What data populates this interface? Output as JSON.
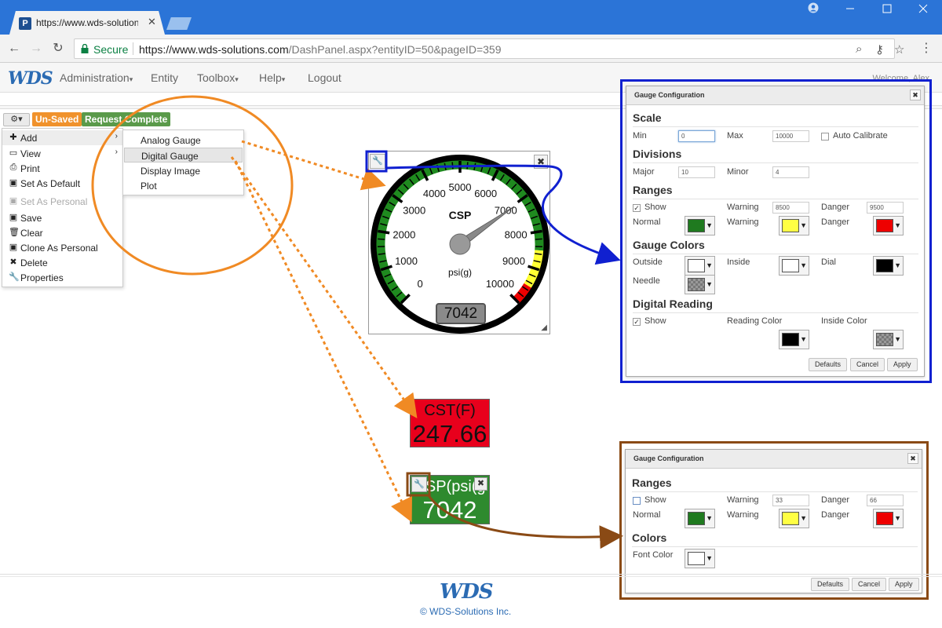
{
  "browser": {
    "tab_title": "https://www.wds-solution",
    "tab_close": "✕",
    "favicon_letter": "P",
    "secure_label": "Secure",
    "url_host": "https://www.wds-solutions.com",
    "url_path": "/DashPanel.aspx?entityID=50&pageID=359",
    "window_controls": [
      "minimize-icon",
      "maximize-icon",
      "close-icon"
    ]
  },
  "app": {
    "logo": "WDS",
    "nav": [
      {
        "label": "Administration",
        "has_dropdown": true
      },
      {
        "label": "Entity",
        "has_dropdown": false
      },
      {
        "label": "Toolbox",
        "has_dropdown": true
      },
      {
        "label": "Help",
        "has_dropdown": true
      },
      {
        "label": "Logout",
        "has_dropdown": false
      }
    ],
    "welcome": "Welcome, Alex"
  },
  "toolbar": {
    "gear": "⚙▾",
    "badge_unsaved": "Un-Saved",
    "badge_complete": "Request Complete"
  },
  "menu": {
    "items": [
      {
        "label": "Add",
        "icon": "plus-icon",
        "submenu": true
      },
      {
        "label": "View",
        "icon": "window-icon",
        "submenu": true
      },
      {
        "label": "Print",
        "icon": "print-icon"
      },
      {
        "label": "Set As Default",
        "icon": "save-icon"
      },
      {
        "label": "Set As Personal",
        "icon": "save-icon",
        "disabled": true
      },
      {
        "label": "Save",
        "icon": "save-icon"
      },
      {
        "label": "Clear",
        "icon": "trash-icon"
      },
      {
        "label": "Clone As Personal",
        "icon": "save-icon"
      },
      {
        "label": "Delete",
        "icon": "x-icon"
      },
      {
        "label": "Properties",
        "icon": "wrench-icon"
      }
    ],
    "submenu": [
      "Analog Gauge",
      "Digital Gauge",
      "Display Image",
      "Plot"
    ],
    "submenu_selected": "Digital Gauge"
  },
  "analog_gauge": {
    "label": "CSP",
    "unit": "psi(g)",
    "min": 0,
    "max": 10000,
    "major": 10,
    "warning_from": 8500,
    "danger_from": 9500,
    "value": 7042,
    "reading": "7042",
    "ticks": [
      "0",
      "1000",
      "2000",
      "3000",
      "4000",
      "5000",
      "6000",
      "7000",
      "8000",
      "9000",
      "10000"
    ],
    "colors": {
      "normal": "#1f8a1f",
      "warning": "#ffff33",
      "danger": "#ee0000",
      "dial": "#000000",
      "inside": "#ffffff",
      "outside": "#ffffff",
      "needle": "#888888"
    }
  },
  "digital_gauges": [
    {
      "label": "CST(F)",
      "value": "247.66",
      "background": "#e8001c"
    },
    {
      "label": "CSP(psi(g",
      "value": "7042",
      "background": "#2e8a2e"
    }
  ],
  "dialog_analog": {
    "title": "Gauge Configuration",
    "scale": {
      "heading": "Scale",
      "min_label": "Min",
      "min": "0",
      "max_label": "Max",
      "max": "10000",
      "auto_label": "Auto Calibrate",
      "auto": false
    },
    "divisions": {
      "heading": "Divisions",
      "major_label": "Major",
      "major": "10",
      "minor_label": "Minor",
      "minor": "4"
    },
    "ranges": {
      "heading": "Ranges",
      "show_label": "Show",
      "show": true,
      "warning_label": "Warning",
      "warning": "8500",
      "danger_label": "Danger",
      "danger": "9500",
      "normal_label": "Normal",
      "normal_color": "#1f7a1f",
      "warning_color": "#ffff44",
      "danger_color": "#ee0000"
    },
    "gauge_colors": {
      "heading": "Gauge Colors",
      "outside_label": "Outside",
      "outside": "#ffffff",
      "inside_label": "Inside",
      "inside": "#ffffff",
      "dial_label": "Dial",
      "dial": "#000000",
      "needle_label": "Needle",
      "needle": "checker"
    },
    "digital_reading": {
      "heading": "Digital Reading",
      "show_label": "Show",
      "show": true,
      "reading_color_label": "Reading Color",
      "reading_color": "#000000",
      "inside_color_label": "Inside Color",
      "inside_color": "checker"
    },
    "buttons": {
      "defaults": "Defaults",
      "cancel": "Cancel",
      "apply": "Apply"
    }
  },
  "dialog_digital": {
    "title": "Gauge Configuration",
    "ranges": {
      "heading": "Ranges",
      "show_label": "Show",
      "show": false,
      "warning_label": "Warning",
      "warning": "33",
      "danger_label": "Danger",
      "danger": "66",
      "normal_label": "Normal",
      "normal_color": "#1f7a1f",
      "warning_color": "#ffff44",
      "danger_color": "#ee0000"
    },
    "colors": {
      "heading": "Colors",
      "font_color_label": "Font Color",
      "font_color": "#ffffff"
    },
    "buttons": {
      "defaults": "Defaults",
      "cancel": "Cancel",
      "apply": "Apply"
    }
  },
  "footer": {
    "logo": "WDS",
    "copyright": "© WDS-Solutions Inc."
  },
  "annotation_colors": {
    "orange": "#f08a24",
    "blue": "#1020d0",
    "brown": "#8a4a15"
  }
}
